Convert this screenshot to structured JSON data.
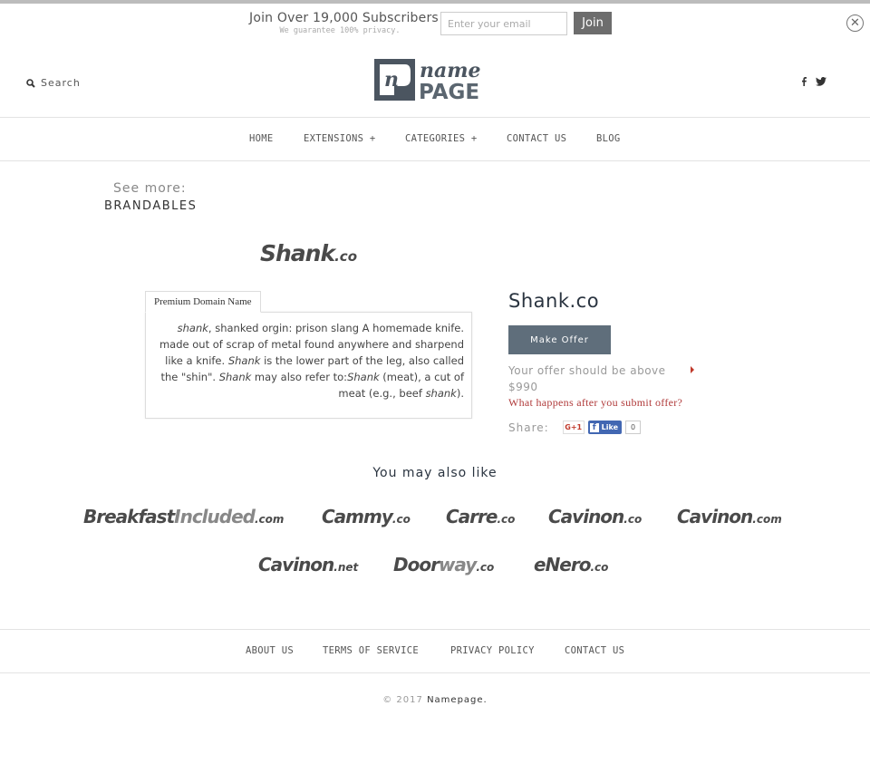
{
  "subscribe": {
    "title": "Join Over 19,000 Subscribers",
    "note": "We guarantee 100% privacy.",
    "email_placeholder": "Enter your email",
    "join_label": "Join",
    "close_icon": "close-circle-icon"
  },
  "header": {
    "search_label": "Search",
    "search_icon": "search-icon",
    "logo_top": "name",
    "logo_bottom": "PAGE",
    "logo_letter": "n",
    "social": [
      "facebook-icon",
      "twitter-icon"
    ]
  },
  "nav": {
    "items": [
      {
        "label": "HOME"
      },
      {
        "label": "EXTENSIONS +"
      },
      {
        "label": "CATEGORIES +"
      },
      {
        "label": "CONTACT US"
      },
      {
        "label": "BLOG"
      }
    ]
  },
  "sidebar": {
    "see_more": "See more:",
    "category": "BRANDABLES"
  },
  "product": {
    "logo_name": "Shank",
    "logo_tld": ".co",
    "tab_label": "Premium Domain Name",
    "description": {
      "p1_italic": "shank",
      "p1": ", shanked orgin: prison slang A homemade knife. made out of scrap of metal found anywhere and sharpend like a knife. ",
      "p2_italic": "Shank",
      "p2": " is the lower part of the leg, also called the \"shin\". ",
      "p3_italic": "Shank",
      "p3": " may also refer to:",
      "p4_italic": "Shank",
      "p4": " (meat), a cut of meat (e.g., beef ",
      "p5_italic": "shank",
      "p5": ")."
    },
    "title": "Shank.co",
    "make_offer_label": "Make Offer",
    "offer_note": "Your offer should be above $990",
    "what_happens": "What happens after you submit offer?",
    "share_label": "Share:",
    "gplus_label": "G+1",
    "fb_like_label": "Like",
    "fb_count": "0"
  },
  "recommendations": {
    "heading": "You may also like",
    "items": [
      {
        "name": "Breakfast",
        "name_light": "Included",
        "tld": ".com"
      },
      {
        "name": "Cammy",
        "name_light": "",
        "tld": ".co"
      },
      {
        "name": "Carre",
        "name_light": "",
        "tld": ".co"
      },
      {
        "name": "Cavinon",
        "name_light": "",
        "tld": ".co"
      },
      {
        "name": "Cavinon",
        "name_light": "",
        "tld": ".com"
      },
      {
        "name": "Cavinon",
        "name_light": "",
        "tld": ".net"
      },
      {
        "name": "Door",
        "name_light": "way",
        "tld": ".co"
      },
      {
        "name": "eNero",
        "name_light": "",
        "tld": ".co"
      }
    ]
  },
  "footer": {
    "links": [
      {
        "label": "ABOUT US"
      },
      {
        "label": "TERMS OF SERVICE"
      },
      {
        "label": "PRIVACY POLICY"
      },
      {
        "label": "CONTACT US"
      }
    ],
    "copyright": "© 2017",
    "brand": "Namepage."
  },
  "colors": {
    "button": "#5f6e7b",
    "join_button": "#6d6d6d",
    "link_red": "#b03a3a",
    "title": "#2a3440"
  }
}
